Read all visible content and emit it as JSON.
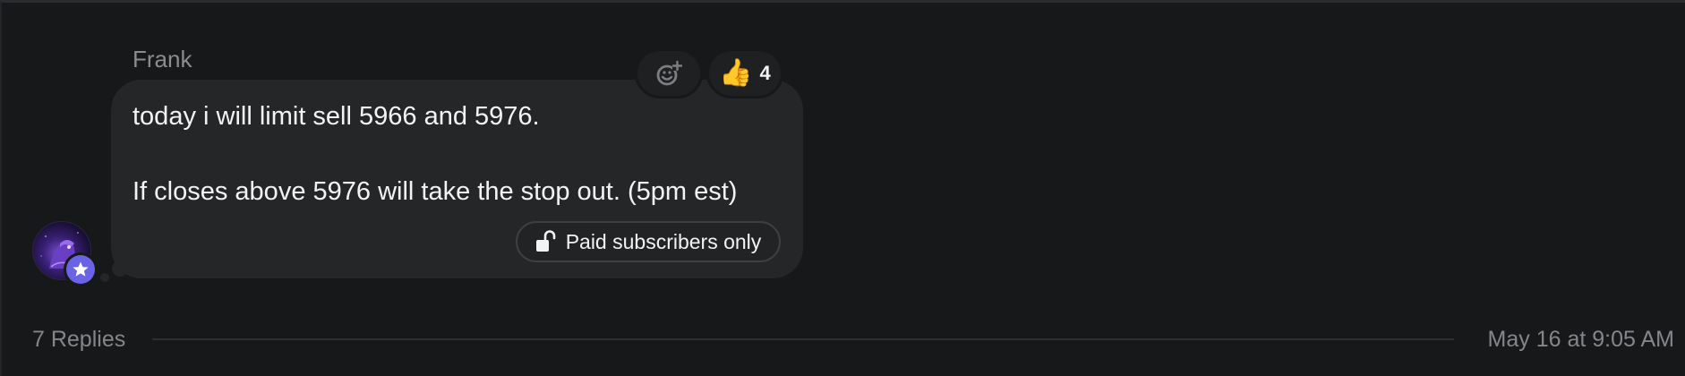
{
  "message": {
    "author": "Frank",
    "text_line_1": "today i will limit sell 5966 and 5976.",
    "text_line_2": "If closes above 5976 will take the stop out. (5pm est)",
    "paid_badge_label": "Paid subscribers only",
    "paid_badge_icon": "unlock-icon",
    "avatar_badge_icon": "star-icon"
  },
  "reactions": {
    "add_reaction_icon": "add-reaction-icon",
    "items": [
      {
        "emoji": "👍",
        "count": "4"
      }
    ]
  },
  "footer": {
    "replies_label": "7 Replies",
    "timestamp": "May 16 at 9:05 AM"
  },
  "colors": {
    "background": "#17181a",
    "bubble": "#252628",
    "muted_text": "#85868a",
    "badge_accent": "#6a63e6"
  }
}
